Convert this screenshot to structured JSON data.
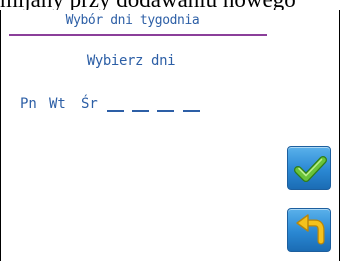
{
  "header_caption": "mijany przy dodawaniu nowego",
  "screen": {
    "title": "Wybór dni tygodnia",
    "prompt": "Wybierz dni",
    "days": [
      "Pn",
      "Wt",
      "Śr"
    ],
    "slot_count": 4
  },
  "buttons": {
    "confirm_icon": "check-icon",
    "back_icon": "back-arrow-icon"
  },
  "colors": {
    "text": "#2d5fa6",
    "title_rule": "#8b3f9a",
    "button_blue": "#2a88d3",
    "check_green": "#6ac33a",
    "arrow_yellow": "#f5c21d"
  }
}
